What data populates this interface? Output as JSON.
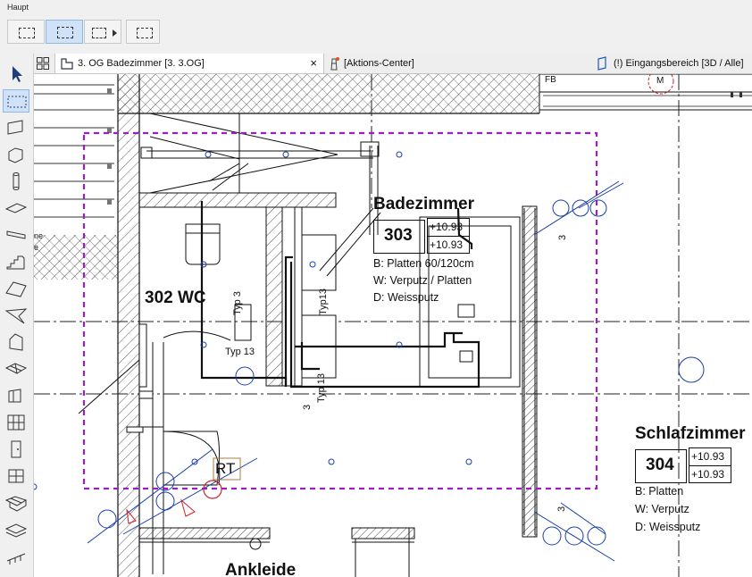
{
  "toolbar": {
    "title": "Haupt"
  },
  "tabs": [
    {
      "label": "3. OG Badezimmer [3. 3.OG]",
      "icon": "floorplan-icon",
      "active": true
    },
    {
      "label": "[Aktions-Center]",
      "icon": "lighthouse-icon",
      "active": false
    },
    {
      "label": "(!) Eingangsbereich [3D / Alle]",
      "icon": "3d-box-icon",
      "active": false
    }
  ],
  "drawing": {
    "rooms": {
      "badezimmer": {
        "name": "Badezimmer",
        "number": "303",
        "level_top": "+10.93",
        "level_bottom": "+10.93",
        "floor": "B: Platten 60/120cm",
        "wall": "W: Verputz / Platten",
        "ceiling": "D: Weissputz"
      },
      "wc": {
        "name": "302 WC"
      },
      "schlafzimmer": {
        "name": "Schlafzimmer",
        "number": "304",
        "level_top": "+10.93",
        "level_bottom": "+10.93",
        "floor": "B: Platten",
        "wall": "W: Verputz",
        "ceiling": "D: Weissputz"
      },
      "ankleide": {
        "name": "Ankleide"
      }
    },
    "labels": {
      "fb": "FB",
      "m_marker": "M",
      "rt": "RT",
      "typ13_a": "Typ 13",
      "typ13_b": "Typ 13",
      "typ13_c": "Typ 13",
      "typ13_d": "Typ13",
      "typ3_a": "Typ 3",
      "num3_a": "3",
      "num3_b": "3",
      "num3_c": "3",
      "ne": "ne",
      "e": "e"
    },
    "colors": {
      "selection": "#9a1fc0",
      "marker_red": "#d0202a",
      "blue": "#1a3fa8",
      "wall_fill": "#7a7a7a"
    }
  }
}
